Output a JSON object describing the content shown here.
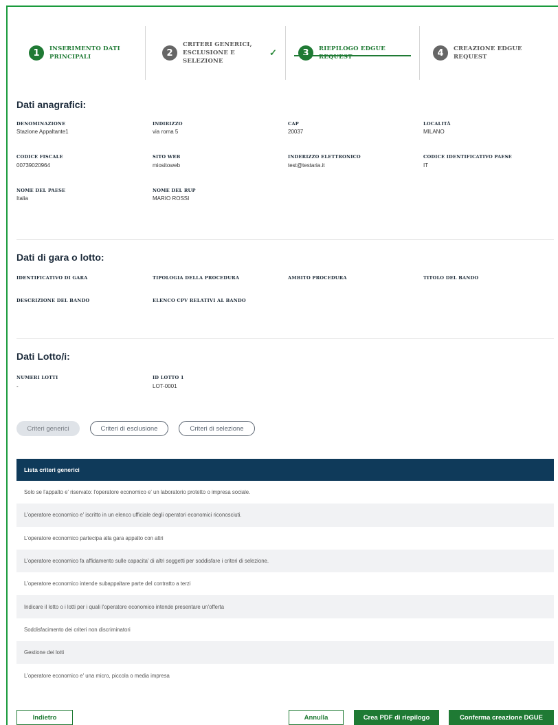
{
  "stepper": {
    "steps": [
      {
        "num": "1",
        "label_line1": "INSERIMENTO DATI",
        "label_line2": "PRINCIPALI",
        "label_line3": ""
      },
      {
        "num": "2",
        "label_line1": "CRITERI GENERICI,",
        "label_line2": "ESCLUSIONE E",
        "label_line3": "SELEZIONE"
      },
      {
        "num": "3",
        "label_line1": "RIEPILOGO EDGUE",
        "label_line2": "REQUEST",
        "label_line3": ""
      },
      {
        "num": "4",
        "label_line1": "CREAZIONE EDGUE",
        "label_line2": "REQUEST",
        "label_line3": ""
      }
    ],
    "check": "✓"
  },
  "anagrafici": {
    "title": "Dati anagrafici:",
    "fields": [
      {
        "label": "DENOMINAZIONE",
        "value": "Stazione Appaltante1"
      },
      {
        "label": "INDIRIZZO",
        "value": "via roma 5"
      },
      {
        "label": "CAP",
        "value": "20037"
      },
      {
        "label": "LOCALITÀ",
        "value": "MILANO"
      },
      {
        "label": "CODICE FISCALE",
        "value": "00739020964"
      },
      {
        "label": "SITO WEB",
        "value": "miositoweb"
      },
      {
        "label": "INDERIZZO ELETTRONICO",
        "value": "test@testaria.it"
      },
      {
        "label": "CODICE IDENTIFICATIVO PAESE",
        "value": "IT"
      },
      {
        "label": "NOME DEL PAESE",
        "value": "Italia"
      },
      {
        "label": "NOME DEL RUP",
        "value": "MARIO ROSSI"
      }
    ]
  },
  "gara": {
    "title": "Dati di gara o lotto:",
    "fields": [
      {
        "label": "IDENTIFICATIVO DI GARA"
      },
      {
        "label": "TIPOLOGIA DELLA PROCEDURA"
      },
      {
        "label": "AMBITO PROCEDURA"
      },
      {
        "label": "TITOLO DEL BANDO"
      },
      {
        "label": "DESCRIZIONE DEL BANDO"
      },
      {
        "label": "ELENCO CPV RELATIVI AL BANDO"
      }
    ]
  },
  "lotti": {
    "title": "Dati Lotto/i:",
    "fields": [
      {
        "label": "NUMERI LOTTI",
        "value": "-"
      },
      {
        "label": "ID LOTTO 1",
        "value": "LOT-0001"
      }
    ]
  },
  "tabs": [
    {
      "label": "Criteri generici",
      "active": true
    },
    {
      "label": "Criteri di esclusione",
      "active": false
    },
    {
      "label": "Criteri di selezione",
      "active": false
    }
  ],
  "table": {
    "header": "Lista criteri generici",
    "rows": [
      "Solo se l'appalto e' riservato: l'operatore economico e' un laboratorio protetto o impresa sociale.",
      "L'operatore economico e' iscritto in un elenco ufficiale degli operatori economici riconosciuti.",
      "L'operatore economico partecipa alla gara appalto con altri",
      "L'operatore economico fa affidamento sulle capacita' di altri soggetti per soddisfare i criteri di selezione.",
      "L'operatore economico intende subappaltare parte del contratto a terzi",
      "Indicare il lotto o i lotti per i quali l'operatore economico intende presentare un'offerta",
      "Soddisfacimento dei criteri non discriminatori",
      "Gestione dei lotti",
      "L'operatore economico e' una micro, piccola o media impresa"
    ]
  },
  "buttons": {
    "back": "Indietro",
    "cancel": "Annulla",
    "pdf": "Crea PDF di riepilogo",
    "confirm": "Conferma creazione DGUE"
  },
  "colors": {
    "accent": "#1f7a34",
    "frame": "#1a9a3c",
    "table_header": "#0f3a5a"
  }
}
